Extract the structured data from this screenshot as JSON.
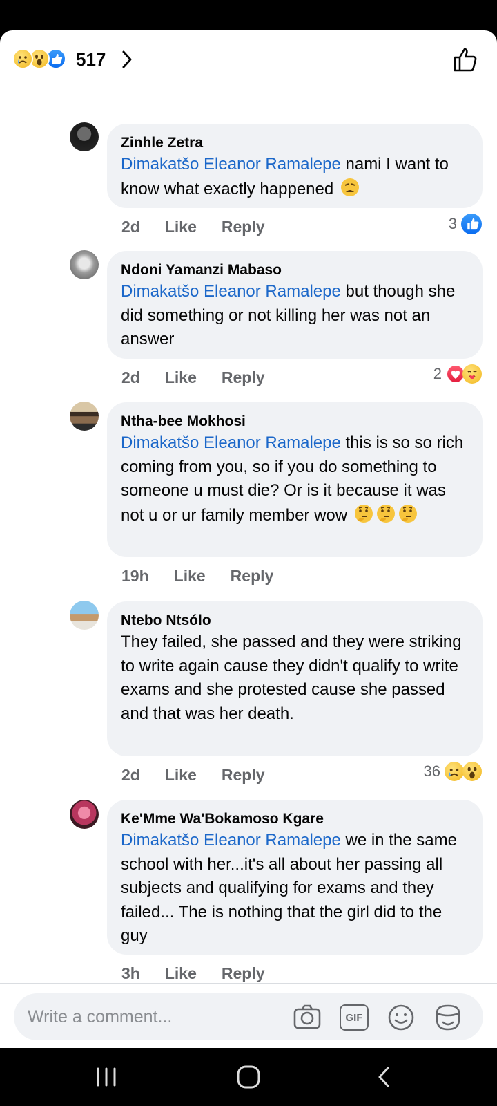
{
  "header": {
    "reaction_count": "517",
    "reaction_icons": [
      "sad-icon",
      "wow-icon",
      "like-icon"
    ]
  },
  "comments": [
    {
      "author": "Zinhle Zetra",
      "mention": "Dimakatšo Eleanor Ramalepe",
      "text": " nami I want to know what exactly happened ",
      "emoji": "weary-face-icon",
      "time": "2d",
      "like_label": "Like",
      "reply_label": "Reply",
      "reaction_count": "3",
      "reactions": [
        "like-icon"
      ]
    },
    {
      "author": "Ndoni Yamanzi Mabaso",
      "mention": "Dimakatšo Eleanor Ramalepe",
      "text": " but though she did something or not killing her was not an answer",
      "time": "2d",
      "like_label": "Like",
      "reply_label": "Reply",
      "reaction_count": "2",
      "reactions": [
        "love-icon",
        "care-icon"
      ]
    },
    {
      "author": "Ntha-bee Mokhosi",
      "mention": "Dimakatšo Eleanor Ramalepe",
      "text": " this is so so rich coming from you,  so if you do something to someone u must die? Or is it because it was not u or ur family member wow ",
      "emoji": "thinking-face-icon",
      "time": "19h",
      "like_label": "Like",
      "reply_label": "Reply"
    },
    {
      "author": "Ntebo Ntsólo",
      "mention": "",
      "text": "They failed, she passed and they were striking to write again cause they didn't qualify to write exams and she protested cause she passed and that was her death.",
      "time": "2d",
      "like_label": "Like",
      "reply_label": "Reply",
      "reaction_count": "36",
      "reactions": [
        "sad-icon",
        "wow-icon"
      ]
    },
    {
      "author": "Ke'Mme Wa'Bokamoso Kgare",
      "mention": "Dimakatšo Eleanor Ramalepe",
      "text": " we in the same school with her...it's all about her passing all subjects and qualifying for exams and they failed... The is nothing that the girl did to the guy",
      "time": "3h",
      "like_label": "Like",
      "reply_label": "Reply"
    }
  ],
  "composer": {
    "placeholder": "Write a comment...",
    "gif_label": "GIF"
  },
  "colors": {
    "mention": "#1b67c9",
    "bubble": "#f0f2f5",
    "meta": "#65676b",
    "like_blue": "#1877f2"
  }
}
